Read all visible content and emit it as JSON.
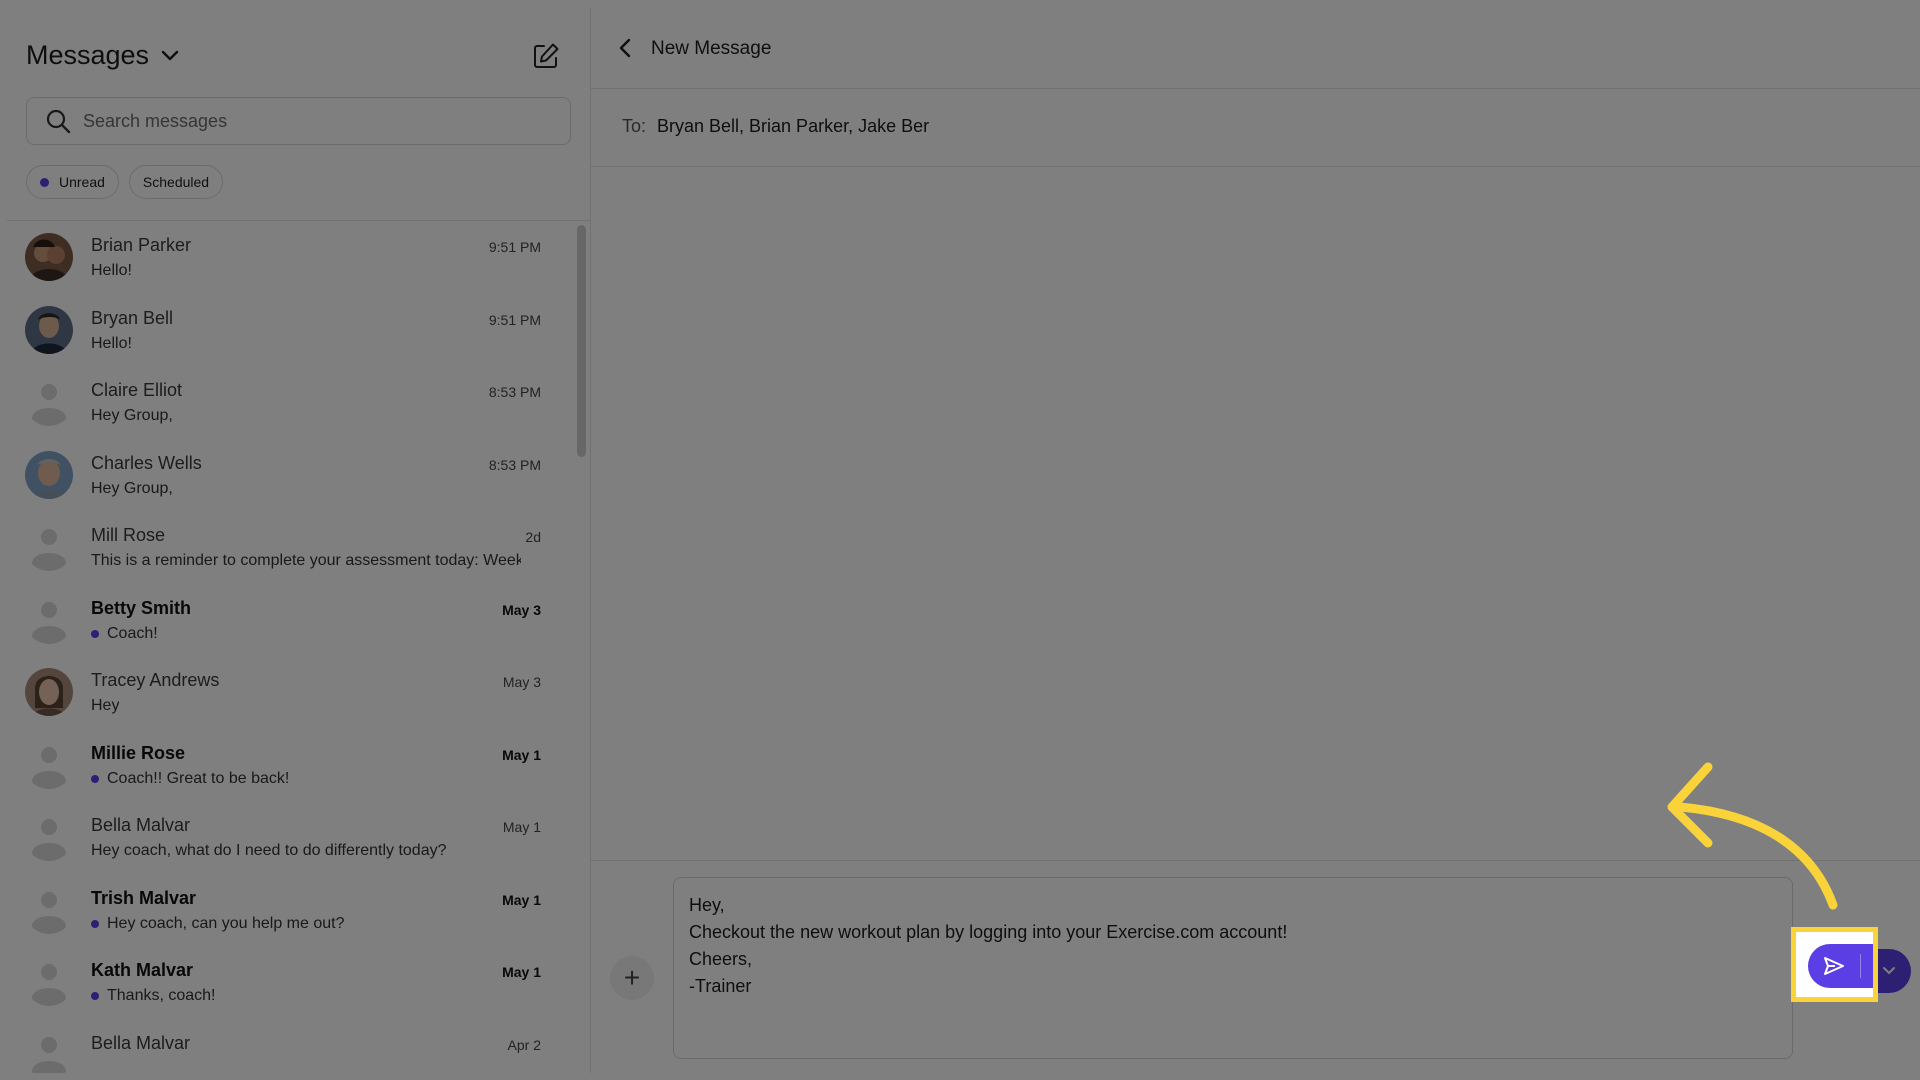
{
  "sidebar": {
    "title": "Messages",
    "search_placeholder": "Search messages",
    "chips": [
      {
        "label": "Unread",
        "dot": true
      },
      {
        "label": "Scheduled",
        "dot": false
      }
    ],
    "conversations": [
      {
        "name": "Brian Parker",
        "time": "9:51 PM",
        "preview": "Hello!",
        "unread": false,
        "avatar": "photo"
      },
      {
        "name": "Bryan Bell",
        "time": "9:51 PM",
        "preview": "Hello!",
        "unread": false,
        "avatar": "photo"
      },
      {
        "name": "Claire Elliot",
        "time": "8:53 PM",
        "preview": "Hey Group,",
        "unread": false,
        "avatar": "placeholder"
      },
      {
        "name": "Charles Wells",
        "time": "8:53 PM",
        "preview": "Hey Group,",
        "unread": false,
        "avatar": "photo"
      },
      {
        "name": "Mill Rose",
        "time": "2d",
        "preview": "This is a reminder to complete your assessment today: Week...",
        "unread": false,
        "avatar": "placeholder"
      },
      {
        "name": "Betty Smith",
        "time": "May 3",
        "preview": "Coach!",
        "unread": true,
        "avatar": "placeholder"
      },
      {
        "name": "Tracey Andrews",
        "time": "May 3",
        "preview": "Hey",
        "unread": false,
        "avatar": "photo"
      },
      {
        "name": "Millie Rose",
        "time": "May 1",
        "preview": "Coach!! Great to be back!",
        "unread": true,
        "avatar": "placeholder"
      },
      {
        "name": "Bella Malvar",
        "time": "May 1",
        "preview": "Hey coach, what do I need to do differently today?",
        "unread": false,
        "avatar": "placeholder"
      },
      {
        "name": "Trish Malvar",
        "time": "May 1",
        "preview": "Hey coach, can you help me out?",
        "unread": true,
        "avatar": "placeholder"
      },
      {
        "name": "Kath Malvar",
        "time": "May 1",
        "preview": "Thanks, coach!",
        "unread": true,
        "avatar": "placeholder"
      },
      {
        "name": "Bella Malvar",
        "time": "Apr 2",
        "preview": "",
        "unread": false,
        "avatar": "placeholder"
      }
    ]
  },
  "main": {
    "title": "New Message",
    "to_label": "To:",
    "to_value": "Bryan Bell, Brian Parker, Jake Ber",
    "message_lines": [
      "Hey,",
      "",
      "Checkout the new workout plan by logging into your Exercise.com account!",
      "",
      "Cheers,",
      "-Trainer"
    ]
  },
  "colors": {
    "accent": "#5b3fe4",
    "highlight": "#f9d339"
  }
}
